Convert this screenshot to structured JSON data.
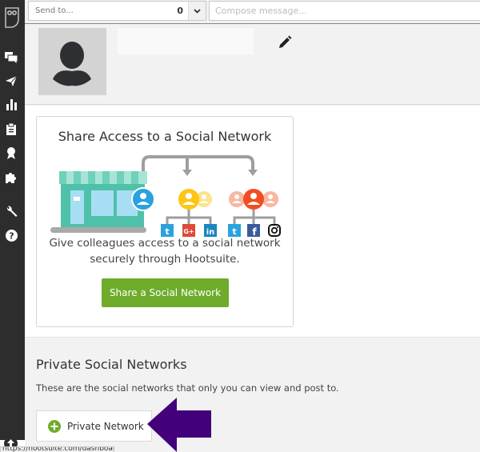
{
  "sidebar": {
    "items": [
      {
        "name": "streams",
        "icon": "chat-bubbles-icon"
      },
      {
        "name": "publisher",
        "icon": "paper-plane-icon"
      },
      {
        "name": "analytics",
        "icon": "bar-chart-icon"
      },
      {
        "name": "assignments",
        "icon": "clipboard-icon"
      },
      {
        "name": "campaigns",
        "icon": "award-ribbon-icon"
      },
      {
        "name": "app-directory",
        "icon": "puzzle-icon"
      },
      {
        "name": "tools",
        "icon": "wrench-icon"
      },
      {
        "name": "help",
        "icon": "question-circle-icon"
      }
    ]
  },
  "topbar": {
    "send_to_placeholder": "Send to...",
    "send_to_count": "0",
    "compose_placeholder": "Compose message..."
  },
  "share_card": {
    "title": "Share Access to a Social Network",
    "description": "Give colleagues access to a social network securely through Hootsuite.",
    "button_label": "Share a Social Network",
    "networks_group1": [
      "twitter",
      "google-plus",
      "linkedin"
    ],
    "networks_group2": [
      "twitter",
      "facebook",
      "instagram"
    ]
  },
  "private_section": {
    "title": "Private Social Networks",
    "description": "These are the social networks that only you can view and post to.",
    "button_label": "Private Network"
  },
  "status_bar": {
    "url": "https://hootsuite.com/dashboard#"
  },
  "colors": {
    "sidebar_bg": "#2d2d2d",
    "share_button": "#6fac2c",
    "plus_icon": "#6fac2c",
    "annotation_arrow": "#43007a",
    "user_blue": "#2ba1de",
    "user_yellow": "#fdc514",
    "user_orange": "#f04f23"
  }
}
